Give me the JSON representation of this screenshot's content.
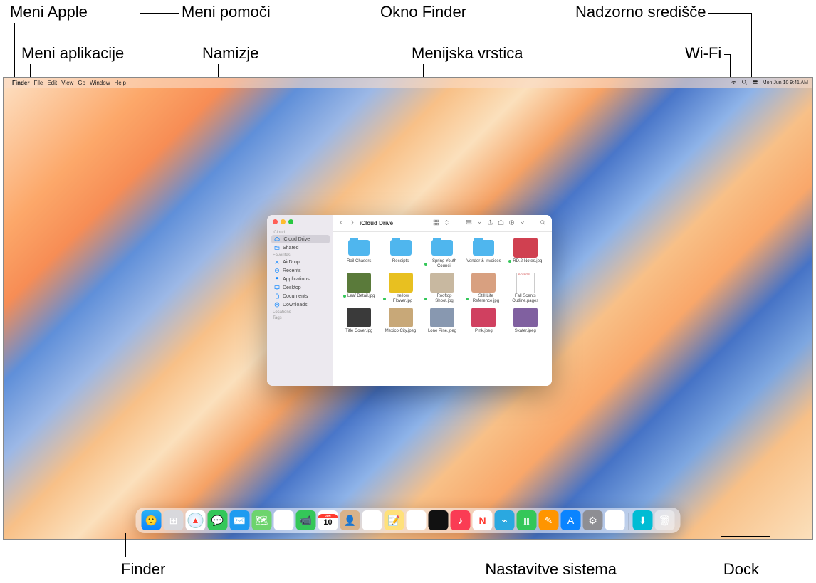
{
  "callouts": {
    "apple_menu": "Meni Apple",
    "app_menu": "Meni aplikacije",
    "help_menu": "Meni pomoči",
    "desktop": "Namizje",
    "finder_window": "Okno Finder",
    "menu_bar": "Menijska vrstica",
    "control_center": "Nadzorno središče",
    "wifi": "Wi-Fi",
    "finder_dock": "Finder",
    "system_settings": "Nastavitve sistema",
    "dock": "Dock"
  },
  "menubar": {
    "app": "Finder",
    "items": [
      "File",
      "Edit",
      "View",
      "Go",
      "Window",
      "Help"
    ],
    "datetime": "Mon Jun 10  9:41 AM"
  },
  "finder": {
    "title": "iCloud Drive",
    "sidebar": {
      "sections": [
        {
          "header": "iCloud",
          "items": [
            {
              "icon": "cloud",
              "label": "iCloud Drive",
              "selected": true
            },
            {
              "icon": "folder-shared",
              "label": "Shared"
            }
          ]
        },
        {
          "header": "Favorites",
          "items": [
            {
              "icon": "airdrop",
              "label": "AirDrop"
            },
            {
              "icon": "clock",
              "label": "Recents"
            },
            {
              "icon": "apps",
              "label": "Applications"
            },
            {
              "icon": "desktop",
              "label": "Desktop"
            },
            {
              "icon": "doc",
              "label": "Documents"
            },
            {
              "icon": "download",
              "label": "Downloads"
            }
          ]
        },
        {
          "header": "Locations",
          "items": []
        },
        {
          "header": "Tags",
          "items": []
        }
      ]
    },
    "files": [
      {
        "name": "Rail Chasers",
        "kind": "folder",
        "tagged": false
      },
      {
        "name": "Receipts",
        "kind": "folder",
        "tagged": false
      },
      {
        "name": "Spring Youth Council",
        "kind": "folder",
        "tagged": true
      },
      {
        "name": "Vendor & Invoices",
        "kind": "folder",
        "tagged": false
      },
      {
        "name": "RD.2-Notes.jpg",
        "kind": "image",
        "tagged": true,
        "bg": "#d04050"
      },
      {
        "name": "Leaf Detail.jpg",
        "kind": "image",
        "tagged": true,
        "bg": "#5a7a3a"
      },
      {
        "name": "Yellow Flower.jpg",
        "kind": "image",
        "tagged": true,
        "bg": "#e8c020"
      },
      {
        "name": "Rooftop Shoot.jpg",
        "kind": "image",
        "tagged": true,
        "bg": "#c8b8a0"
      },
      {
        "name": "Still Life Reference.jpg",
        "kind": "image",
        "tagged": true,
        "bg": "#d8a080"
      },
      {
        "name": "Fall Scents Outline.pages",
        "kind": "pages",
        "tagged": false
      },
      {
        "name": "Title Cover.jpg",
        "kind": "image",
        "tagged": false,
        "bg": "#3a3a3a"
      },
      {
        "name": "Mexico City.jpeg",
        "kind": "image",
        "tagged": false,
        "bg": "#c8a878"
      },
      {
        "name": "Lone Pine.jpeg",
        "kind": "image",
        "tagged": false,
        "bg": "#8898b0"
      },
      {
        "name": "Pink.jpeg",
        "kind": "image",
        "tagged": false,
        "bg": "#d04060"
      },
      {
        "name": "Skater.jpeg",
        "kind": "image",
        "tagged": false,
        "bg": "#8060a0"
      }
    ]
  },
  "dock": {
    "items": [
      {
        "name": "finder",
        "bg": "linear-gradient(#2bb0f5,#0a84ff)",
        "glyph": "🙂"
      },
      {
        "name": "launchpad",
        "bg": "#d8d8dc",
        "glyph": "⊞"
      },
      {
        "name": "safari",
        "bg": "#fff",
        "glyph": "🧭"
      },
      {
        "name": "messages",
        "bg": "#34c759",
        "glyph": "💬"
      },
      {
        "name": "mail",
        "bg": "#1e9bf0",
        "glyph": "✉️"
      },
      {
        "name": "maps",
        "bg": "#6dd46d",
        "glyph": "🗺"
      },
      {
        "name": "photos",
        "bg": "#fff",
        "glyph": "❀"
      },
      {
        "name": "facetime",
        "bg": "#34c759",
        "glyph": "📹"
      },
      {
        "name": "calendar",
        "bg": "#fff",
        "glyph": "10"
      },
      {
        "name": "contacts",
        "bg": "#d8b28a",
        "glyph": "👤"
      },
      {
        "name": "reminders",
        "bg": "#fff",
        "glyph": "☰"
      },
      {
        "name": "notes",
        "bg": "#ffe17a",
        "glyph": "📝"
      },
      {
        "name": "freeform",
        "bg": "#fff",
        "glyph": "✎"
      },
      {
        "name": "tv",
        "bg": "#111",
        "glyph": ""
      },
      {
        "name": "music",
        "bg": "#fa3c54",
        "glyph": "♪"
      },
      {
        "name": "news",
        "bg": "#fff",
        "glyph": "N"
      },
      {
        "name": "podcasts",
        "bg": "#2aa8e0",
        "glyph": "⌁"
      },
      {
        "name": "numbers",
        "bg": "#34c759",
        "glyph": "▥"
      },
      {
        "name": "pages",
        "bg": "#ff9500",
        "glyph": "✎"
      },
      {
        "name": "appstore",
        "bg": "#0a84ff",
        "glyph": "A"
      },
      {
        "name": "system-settings",
        "bg": "#8e8e93",
        "glyph": "⚙︎"
      },
      {
        "name": "iphone-mirroring",
        "bg": "#fff",
        "glyph": "▮"
      }
    ],
    "after_sep": [
      {
        "name": "downloads-stack",
        "bg": "#00bcd4",
        "glyph": "⬇"
      },
      {
        "name": "trash",
        "bg": "rgba(255,255,255,0.4)",
        "glyph": "🗑"
      }
    ]
  }
}
